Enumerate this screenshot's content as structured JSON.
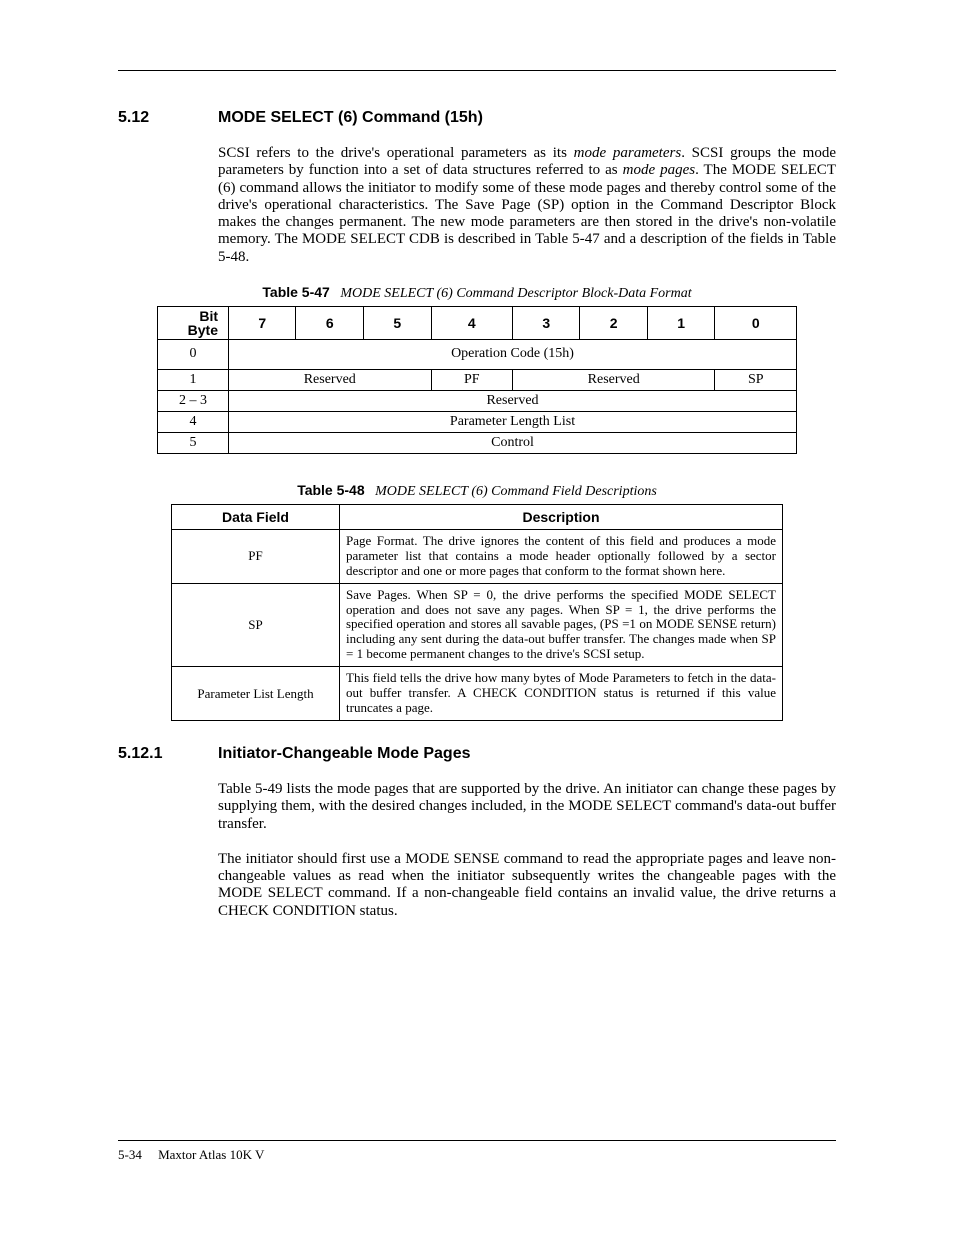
{
  "section": {
    "num": "5.12",
    "title": "MODE SELECT (6) Command (15h)",
    "body_html": "SCSI refers to the drive's operational parameters as its <span class=\"italic\">mode parameters</span>. SCSI groups the mode parameters by function into a set of data structures referred to as <span class=\"italic\">mode pages</span>. The MODE SELECT (6) command allows the initiator to modify some of these mode pages and thereby control some of the drive's operational characteristics. The Save Page (SP) option in the Command Descriptor Block makes the changes permanent. The new mode parameters are then stored in the drive's non-volatile memory. The MODE SELECT CDB is described in Table 5-47 and a description of the fields in Table 5-48."
  },
  "table47": {
    "label": "Table 5-47",
    "title": "MODE SELECT (6) Command Descriptor Block-Data Format",
    "corner_top": "Bit",
    "corner_bot": "Byte",
    "bits": [
      "7",
      "6",
      "5",
      "4",
      "3",
      "2",
      "1",
      "0"
    ],
    "rows": {
      "r0_byte": "0",
      "r0_text": "Operation Code (15h)",
      "r1_byte": "1",
      "r1_c1": "Reserved",
      "r1_c2": "PF",
      "r1_c3": "Reserved",
      "r1_c4": "SP",
      "r2_byte": "2 – 3",
      "r2_text": "Reserved",
      "r3_byte": "4",
      "r3_text": "Parameter Length List",
      "r4_byte": "5",
      "r4_text": "Control"
    }
  },
  "table48": {
    "label": "Table 5-48",
    "title": "MODE SELECT (6) Command Field Descriptions",
    "head_field": "Data Field",
    "head_desc": "Description",
    "rows": [
      {
        "field": "PF",
        "desc": "Page Format. The drive ignores the content of this field and produces a mode parameter list that contains a mode header optionally followed by a sector descriptor and one or more pages that conform to the format shown here."
      },
      {
        "field": "SP",
        "desc": "Save Pages. When SP = 0, the drive performs the specified MODE SELECT operation and does not save any pages. When SP = 1, the drive performs the specified operation and stores all savable pages, (PS =1 on MODE SENSE return) including any sent during the data-out buffer transfer. The changes made when SP = 1 become permanent changes to the drive's SCSI setup."
      },
      {
        "field": "Parameter List Length",
        "desc": "This field tells the drive how many bytes of Mode Parameters to fetch in the data-out buffer transfer. A CHECK CONDITION status is returned if this value truncates a page."
      }
    ]
  },
  "subsection": {
    "num": "5.12.1",
    "title": "Initiator-Changeable Mode Pages",
    "para1": "Table 5-49 lists the mode pages that are supported by the drive. An initiator can change these pages by supplying them, with the desired changes included, in the MODE SELECT command's data-out buffer transfer.",
    "para2": "The initiator should first use a MODE SENSE command to read the appropriate pages and leave non-changeable values as read when the initiator subsequently writes the changeable pages with the MODE SELECT command. If a non-changeable field contains an invalid value, the drive returns a CHECK CONDITION status."
  },
  "footer": {
    "page": "5-34",
    "doc": "Maxtor Atlas 10K V"
  }
}
